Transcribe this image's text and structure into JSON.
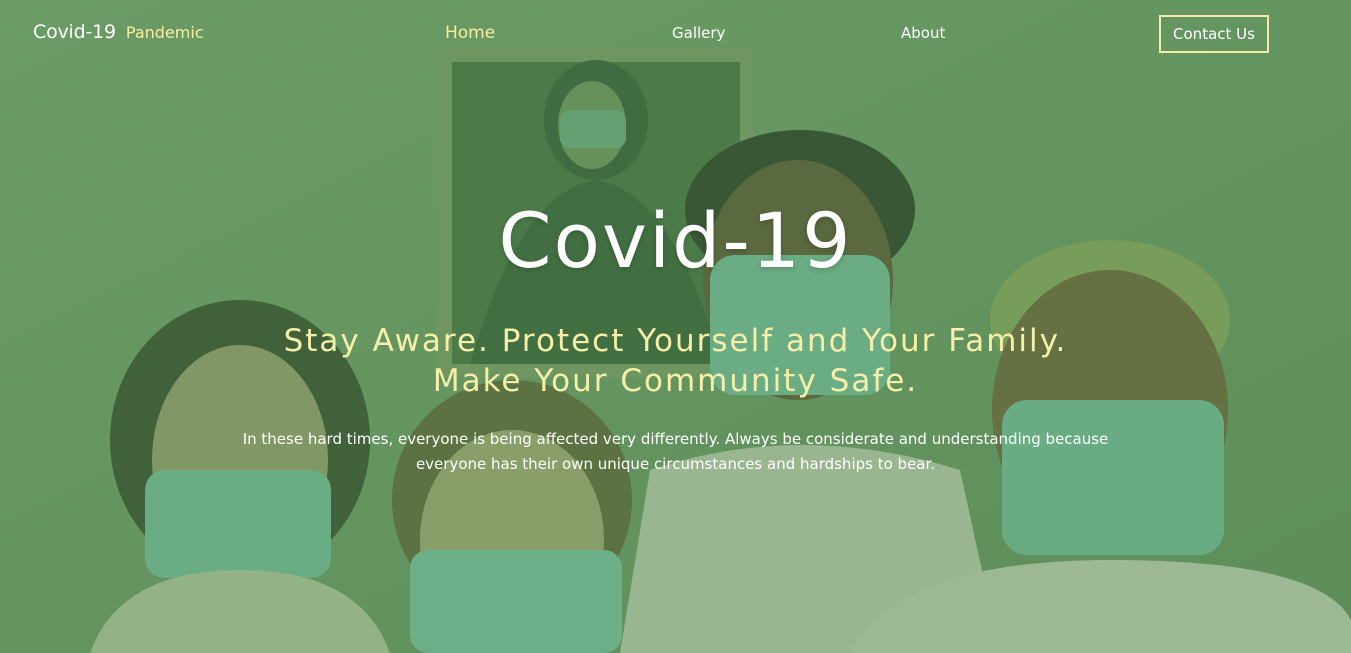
{
  "nav": {
    "brand_main": "Covid-19",
    "brand_sub": "Pandemic",
    "links": [
      {
        "label": "Home"
      },
      {
        "label": "Gallery"
      },
      {
        "label": "About"
      }
    ],
    "contact_label": "Contact Us"
  },
  "hero": {
    "title": "Covid-19",
    "subtitle_line1": "Stay Aware. Protect Yourself and Your Family.",
    "subtitle_line2": "Make Your Community Safe.",
    "body_line1": "In these hard times, everyone is being affected very differently. Always be considerate and understanding because",
    "body_line2": "everyone has their own unique circumstances and hardships to bear."
  },
  "colors": {
    "overlay_green": "#5e9361",
    "accent_yellow": "#f8eea2",
    "text_white": "#ffffff"
  }
}
